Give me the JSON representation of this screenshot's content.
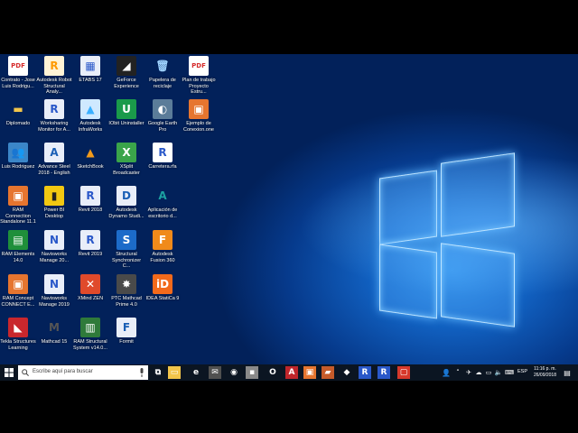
{
  "desktop": {
    "icons": [
      {
        "label": "Contrato - Jose Luis Rodrigu...",
        "glyph": "PDF",
        "color": "#d62c2c",
        "bg": "#fff"
      },
      {
        "label": "Autodesk Robot Structural Analy...",
        "glyph": "R",
        "color": "#ff9a00",
        "bg": "#fff3d6"
      },
      {
        "label": "ETABS 17",
        "glyph": "▦",
        "color": "#2a58c9",
        "bg": "#e9eef9"
      },
      {
        "label": "GeForce Experience",
        "glyph": "◢",
        "color": "#fff",
        "bg": "#222"
      },
      {
        "label": "Papelera de reciclaje",
        "glyph": "🗑",
        "color": "#9fd3ff",
        "bg": "transparent"
      },
      {
        "label": "Plan de trabajo Proyecto Estru...",
        "glyph": "PDF",
        "color": "#d62c2c",
        "bg": "#fff"
      },
      {
        "label": "Diplomado",
        "glyph": "▬",
        "color": "#f2c54a",
        "bg": "transparent"
      },
      {
        "label": "Worksharing Monitor for A...",
        "glyph": "R",
        "color": "#2a58c9",
        "bg": "#e9eef9"
      },
      {
        "label": "Autodesk InfraWorks",
        "glyph": "▲",
        "color": "#3ab0ff",
        "bg": "#cfe9ff"
      },
      {
        "label": "IObit Uninstaller",
        "glyph": "U",
        "color": "#fff",
        "bg": "#1a9a4a"
      },
      {
        "label": "Google Earth Pro",
        "glyph": "◐",
        "color": "#fff",
        "bg": "#5b7c99"
      },
      {
        "label": "Ejemplo de Conexion.one",
        "glyph": "▣",
        "color": "#fff",
        "bg": "#e6752f"
      },
      {
        "label": "Luis Rodriguez",
        "glyph": "👥",
        "color": "#fff",
        "bg": "#3b86c8"
      },
      {
        "label": "Advance Steel 2018 - English",
        "glyph": "A",
        "color": "#1a5fb5",
        "bg": "#e9eef9"
      },
      {
        "label": "SketchBook",
        "glyph": "▲",
        "color": "#f29a1b",
        "bg": "transparent"
      },
      {
        "label": "XSplit Broadcaster",
        "glyph": "X",
        "color": "#fff",
        "bg": "#3aa44a"
      },
      {
        "label": "Carretera.rfa",
        "glyph": "R",
        "color": "#2a58c9",
        "bg": "#fff"
      },
      {
        "label": "",
        "glyph": "",
        "color": "#fff",
        "bg": "transparent"
      },
      {
        "label": "RAM Connection Standalone 11.1",
        "glyph": "▣",
        "color": "#fff",
        "bg": "#e6752f"
      },
      {
        "label": "Power BI Desktop",
        "glyph": "▮",
        "color": "#222",
        "bg": "#f2c811"
      },
      {
        "label": "Revit 2018",
        "glyph": "R",
        "color": "#2a58c9",
        "bg": "#e9eef9"
      },
      {
        "label": "Autodesk Dynamo Studi...",
        "glyph": "D",
        "color": "#1a5fb5",
        "bg": "#e9eef9"
      },
      {
        "label": "Aplicación de escritorio d...",
        "glyph": "A",
        "color": "#1ca1a1",
        "bg": "transparent"
      },
      {
        "label": "",
        "glyph": "",
        "color": "#fff",
        "bg": "transparent"
      },
      {
        "label": "RAM Elements 14.0",
        "glyph": "▤",
        "color": "#fff",
        "bg": "#1f8f3a"
      },
      {
        "label": "Navisworks Manage 20...",
        "glyph": "N",
        "color": "#2a58c9",
        "bg": "#e9eef9"
      },
      {
        "label": "Revit 2019",
        "glyph": "R",
        "color": "#2a58c9",
        "bg": "#e9eef9"
      },
      {
        "label": "Structural Synchronizer C...",
        "glyph": "S",
        "color": "#fff",
        "bg": "#1c6bc9"
      },
      {
        "label": "Autodesk Fusion 360",
        "glyph": "F",
        "color": "#fff",
        "bg": "#f08a1a"
      },
      {
        "label": "",
        "glyph": "",
        "color": "#fff",
        "bg": "transparent"
      },
      {
        "label": "RAM Concept CONNECT E...",
        "glyph": "▣",
        "color": "#fff",
        "bg": "#e6752f"
      },
      {
        "label": "Navisworks Manage 2019",
        "glyph": "N",
        "color": "#2a58c9",
        "bg": "#e9eef9"
      },
      {
        "label": "XMind ZEN",
        "glyph": "✕",
        "color": "#fff",
        "bg": "#e04a2b"
      },
      {
        "label": "PTC Mathcad Prime 4.0",
        "glyph": "✸",
        "color": "#fff",
        "bg": "#4a4a4a"
      },
      {
        "label": "IDEA StatiCa 9",
        "glyph": "iD",
        "color": "#fff",
        "bg": "#f26a1b"
      },
      {
        "label": "",
        "glyph": "",
        "color": "#fff",
        "bg": "transparent"
      },
      {
        "label": "Tekla Structures Learning",
        "glyph": "◣",
        "color": "#fff",
        "bg": "#c9272d"
      },
      {
        "label": "Mathcad 15",
        "glyph": "M",
        "color": "#555",
        "bg": "transparent"
      },
      {
        "label": "RAM Structural System v14.0...",
        "glyph": "▥",
        "color": "#fff",
        "bg": "#2f7a3a"
      },
      {
        "label": "Formit",
        "glyph": "F",
        "color": "#1a5fb5",
        "bg": "#e9eef9"
      }
    ]
  },
  "taskbar": {
    "search_placeholder": "Escribe aquí para buscar",
    "start_icon": "windows-start-icon",
    "pinned": [
      {
        "name": "task-view-icon",
        "glyph": "⧉",
        "bg": "transparent"
      },
      {
        "name": "file-explorer-icon",
        "glyph": "▭",
        "bg": "#f2c54a"
      },
      {
        "name": "edge-icon",
        "glyph": "e",
        "bg": "transparent"
      },
      {
        "name": "mail-icon",
        "glyph": "✉",
        "bg": "#505050"
      },
      {
        "name": "chrome-icon",
        "glyph": "◉",
        "bg": "transparent"
      },
      {
        "name": "gray-app-icon",
        "glyph": "▪",
        "bg": "#8a8a8a"
      },
      {
        "name": "opera-icon",
        "glyph": "O",
        "bg": "transparent"
      },
      {
        "name": "autocad-icon",
        "glyph": "A",
        "bg": "#c0262b"
      },
      {
        "name": "ram-connection-icon",
        "glyph": "▣",
        "bg": "#e6752f"
      },
      {
        "name": "photo-app-icon",
        "glyph": "▰",
        "bg": "#c65b2a"
      },
      {
        "name": "drive-icon",
        "glyph": "◆",
        "bg": "transparent"
      },
      {
        "name": "revit-2018-icon",
        "glyph": "R",
        "bg": "#2a58c9"
      },
      {
        "name": "revit-2019-icon",
        "glyph": "R",
        "bg": "#2a58c9"
      },
      {
        "name": "red-app-icon",
        "glyph": "▢",
        "bg": "#d6382b"
      }
    ],
    "tray": {
      "language": "ESP",
      "time": "11:16 p. m.",
      "date": "26/09/2018"
    }
  }
}
